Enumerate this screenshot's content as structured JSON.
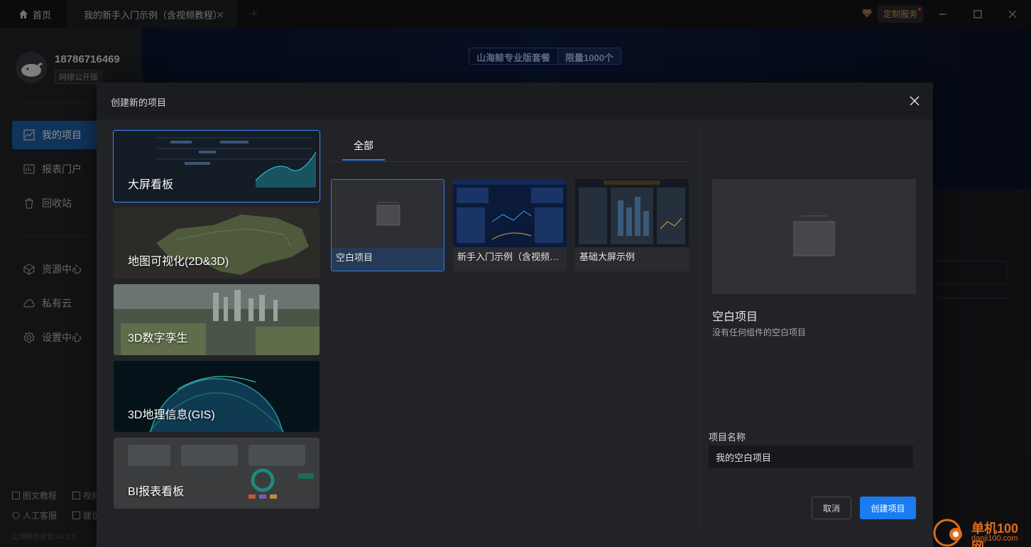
{
  "titlebar": {
    "home_tab": "首页",
    "doc_tab": "我的新手入门示例（含视频教程）",
    "custom_service": "定制服务"
  },
  "sidebar": {
    "username": "18786716469",
    "edition": "网络公开版",
    "nav": [
      {
        "label": "我的项目",
        "icon": "chart-icon",
        "active": true
      },
      {
        "label": "报表门户",
        "icon": "report-icon"
      },
      {
        "label": "回收站",
        "icon": "trash-icon"
      },
      {
        "label": "资源中心",
        "icon": "cube-icon"
      },
      {
        "label": "私有云",
        "icon": "cloud-icon"
      },
      {
        "label": "设置中心",
        "icon": "gear-icon"
      }
    ],
    "footer": {
      "tutorial": "图文教程",
      "video": "视频",
      "support": "人工客服",
      "suggest": "建议",
      "version": "山海鲸可视化 v4.3.5"
    }
  },
  "banner": {
    "pill1": "山海鲸专业版套餐",
    "pill2": "限量1000个"
  },
  "modal": {
    "title": "创建新的项目",
    "categories": [
      {
        "label": "大屏看板",
        "active": true
      },
      {
        "label": "地图可视化(2D&3D)"
      },
      {
        "label": "3D数字孪生"
      },
      {
        "label": "3D地理信息(GIS)"
      },
      {
        "label": "BI报表看板"
      }
    ],
    "filter_tab": "全部",
    "templates": [
      {
        "label": "空白项目",
        "selected": true
      },
      {
        "label": "新手入门示例（含视频教程）"
      },
      {
        "label": "基础大屏示例"
      }
    ],
    "preview": {
      "title": "空白项目",
      "desc": "没有任何组件的空白项目"
    },
    "name_label": "项目名称",
    "name_value": "我的空白项目",
    "cancel": "取消",
    "create": "创建项目"
  },
  "watermark": {
    "brand": "单机100网",
    "url": "danji100.com"
  },
  "colors": {
    "accent": "#1a7cf0",
    "active_nav": "#1e5fa8",
    "modal_bg": "#222327"
  }
}
